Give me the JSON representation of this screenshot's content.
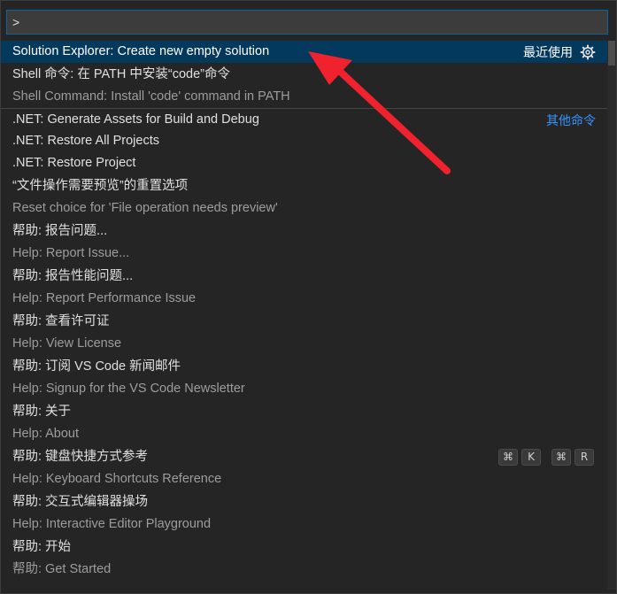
{
  "input": {
    "value": ">"
  },
  "selected": {
    "label": "Solution Explorer: Create new empty solution",
    "badge": "最近使用",
    "icon": "gear-icon"
  },
  "items": [
    {
      "label": "Shell 命令: 在 PATH 中安装“code”命令",
      "detail": "Shell Command: Install 'code' command in PATH"
    },
    {
      "label": ".NET: Generate Assets for Build and Debug",
      "badge": "其他命令"
    },
    {
      "label": ".NET: Restore All Projects"
    },
    {
      "label": ".NET: Restore Project"
    },
    {
      "label": "“文件操作需要预览”的重置选项",
      "detail": "Reset choice for 'File operation needs preview'"
    },
    {
      "label": "帮助: 报告问题...",
      "detail": "Help: Report Issue..."
    },
    {
      "label": "帮助: 报告性能问题...",
      "detail": "Help: Report Performance Issue"
    },
    {
      "label": "帮助: 查看许可证",
      "detail": "Help: View License"
    },
    {
      "label": "帮助: 订阅 VS Code 新闻邮件",
      "detail": "Help: Signup for the VS Code Newsletter"
    },
    {
      "label": "帮助: 关于",
      "detail": "Help: About"
    },
    {
      "label": "帮助: 键盘快捷方式参考",
      "detail": "Help: Keyboard Shortcuts Reference",
      "keys": [
        "⌘",
        "K",
        "⌘",
        "R"
      ]
    },
    {
      "label": "帮助: 交互式编辑器操场",
      "detail": "Help: Interactive Editor Playground"
    },
    {
      "label": "帮助: 开始",
      "detail": "帮助: Get Started"
    }
  ],
  "colors": {
    "accent": "#04395e",
    "arrow": "#f0222e",
    "link": "#3794ff"
  }
}
